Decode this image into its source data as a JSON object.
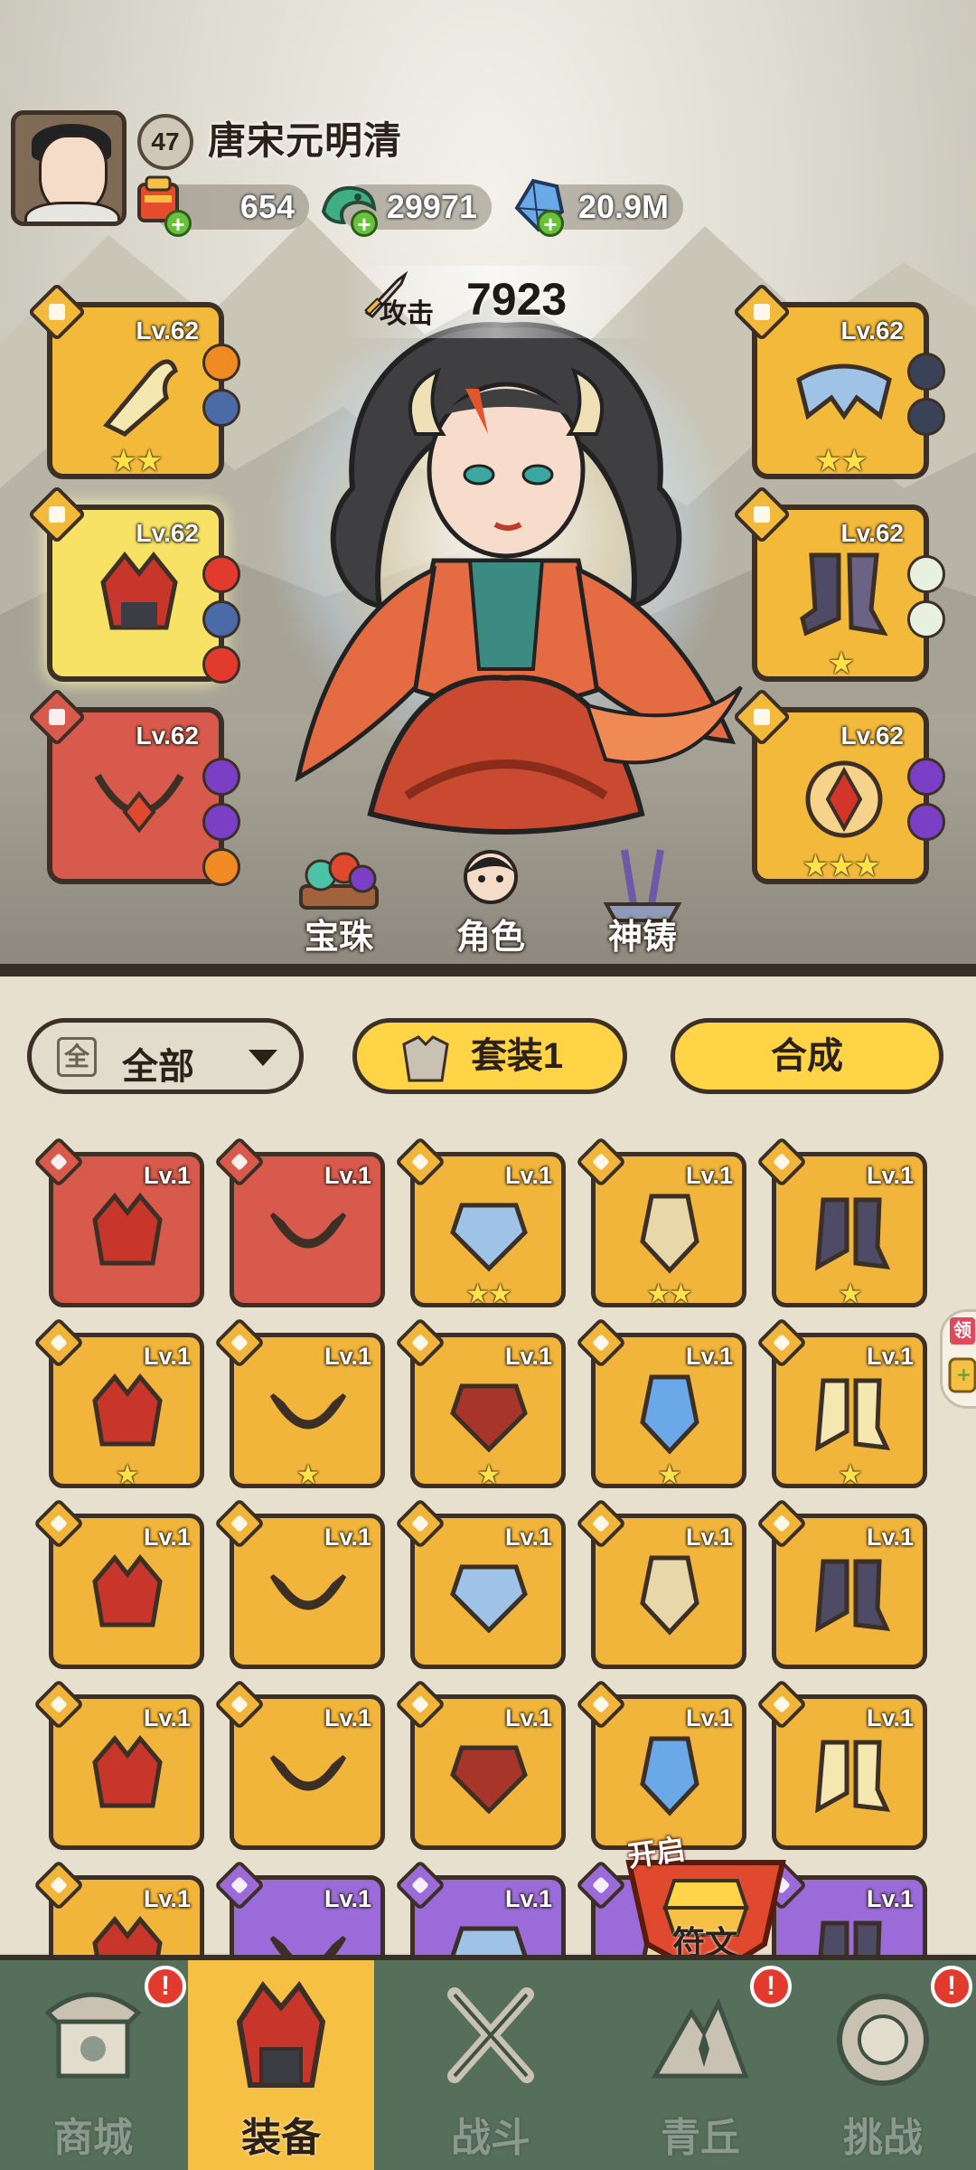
{
  "player": {
    "level": "47",
    "name": "唐宋元明清"
  },
  "resources": [
    {
      "name": "scroll-currency",
      "value": "654"
    },
    {
      "name": "jade-dragon-currency",
      "value": "29971"
    },
    {
      "name": "crystal-currency",
      "value": "20.9M"
    }
  ],
  "attack": {
    "label": "攻击",
    "value": "7923"
  },
  "equipped": {
    "left": [
      {
        "level": "Lv.62",
        "stars": "★★",
        "rarity": "gold"
      },
      {
        "level": "Lv.62",
        "stars": "",
        "rarity": "gold"
      },
      {
        "level": "Lv.62",
        "stars": "",
        "rarity": "red"
      }
    ],
    "right": [
      {
        "level": "Lv.62",
        "stars": "★★",
        "rarity": "gold"
      },
      {
        "level": "Lv.62",
        "stars": "★",
        "rarity": "gold"
      },
      {
        "level": "Lv.62",
        "stars": "★★★",
        "rarity": "gold"
      }
    ]
  },
  "quick_actions": [
    {
      "label": "宝珠"
    },
    {
      "label": "角色"
    },
    {
      "label": "神铸"
    }
  ],
  "filter": {
    "all_icon": "全",
    "label": "全部"
  },
  "buttons": {
    "set": "套装1",
    "combine": "合成"
  },
  "inventory": [
    {
      "level": "Lv.1",
      "stars": "",
      "rarity": "red"
    },
    {
      "level": "Lv.1",
      "stars": "",
      "rarity": "red"
    },
    {
      "level": "Lv.1",
      "stars": "★★",
      "rarity": "gold"
    },
    {
      "level": "Lv.1",
      "stars": "★★",
      "rarity": "gold"
    },
    {
      "level": "Lv.1",
      "stars": "★",
      "rarity": "gold"
    },
    {
      "level": "Lv.1",
      "stars": "★",
      "rarity": "gold"
    },
    {
      "level": "Lv.1",
      "stars": "★",
      "rarity": "gold"
    },
    {
      "level": "Lv.1",
      "stars": "★",
      "rarity": "gold"
    },
    {
      "level": "Lv.1",
      "stars": "★",
      "rarity": "gold"
    },
    {
      "level": "Lv.1",
      "stars": "★",
      "rarity": "gold"
    },
    {
      "level": "Lv.1",
      "stars": "",
      "rarity": "gold"
    },
    {
      "level": "Lv.1",
      "stars": "",
      "rarity": "gold"
    },
    {
      "level": "Lv.1",
      "stars": "",
      "rarity": "gold"
    },
    {
      "level": "Lv.1",
      "stars": "",
      "rarity": "gold"
    },
    {
      "level": "Lv.1",
      "stars": "",
      "rarity": "gold"
    },
    {
      "level": "Lv.1",
      "stars": "",
      "rarity": "gold"
    },
    {
      "level": "Lv.1",
      "stars": "",
      "rarity": "gold"
    },
    {
      "level": "Lv.1",
      "stars": "",
      "rarity": "gold"
    },
    {
      "level": "Lv.1",
      "stars": "",
      "rarity": "gold"
    },
    {
      "level": "Lv.1",
      "stars": "",
      "rarity": "gold"
    },
    {
      "level": "Lv.1",
      "stars": "",
      "rarity": "gold"
    },
    {
      "level": "Lv.1",
      "stars": "",
      "rarity": "purple"
    },
    {
      "level": "Lv.1",
      "stars": "",
      "rarity": "purple"
    },
    {
      "level": "",
      "stars": "",
      "rarity": "purple"
    },
    {
      "level": "Lv.1",
      "stars": "",
      "rarity": "purple"
    }
  ],
  "rune": {
    "open_label": "开启",
    "label": "符文"
  },
  "side_tab": {
    "label": "领"
  },
  "nav": [
    {
      "label": "商城",
      "badge": "!"
    },
    {
      "label": "装备",
      "badge": ""
    },
    {
      "label": "战斗",
      "badge": ""
    },
    {
      "label": "青丘",
      "badge": "!"
    },
    {
      "label": "挑战",
      "badge": "!"
    }
  ],
  "colors": {
    "gold_slot": "#f0b53a",
    "red_slot": "#d75a4c",
    "purple_slot": "#9b6cd9",
    "nav_bg": "#556f5a",
    "nav_active": "#f5c043",
    "badge": "#e23b2e"
  }
}
